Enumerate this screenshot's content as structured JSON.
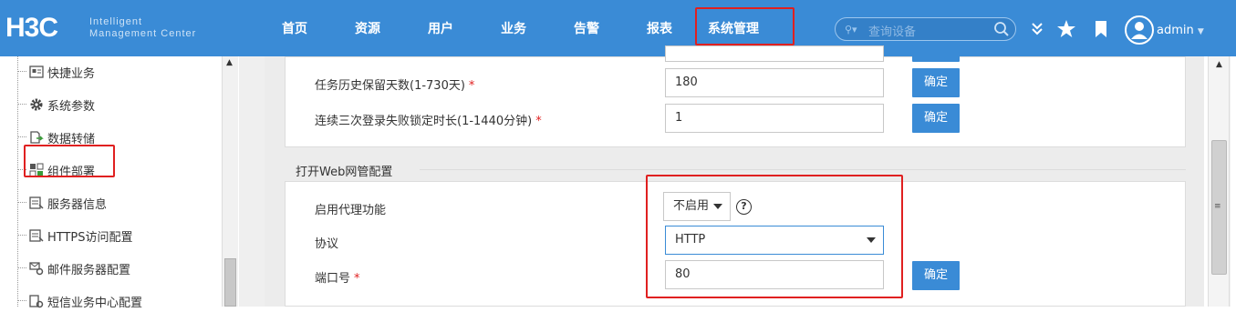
{
  "header": {
    "logo_main": "H3C",
    "logo_line1": "Intelligent",
    "logo_line2": "Management Center",
    "nav": [
      {
        "label": "首页"
      },
      {
        "label": "资源"
      },
      {
        "label": "用户"
      },
      {
        "label": "业务"
      },
      {
        "label": "告警"
      },
      {
        "label": "报表"
      },
      {
        "label": "系统管理",
        "active": true
      }
    ],
    "search": {
      "placeholder": "查询设备",
      "icon": "search-icon"
    },
    "icons": [
      "double-chevron-down-icon",
      "star-icon",
      "bookmark-icon",
      "user-avatar-icon"
    ],
    "user": "admin",
    "accent": "#3a8bd6",
    "highlight": "#e02020"
  },
  "sidebar": {
    "items": [
      {
        "label": "快捷业务",
        "icon": "shortcut-icon"
      },
      {
        "label": "系统参数",
        "icon": "gear-icon",
        "selected": true
      },
      {
        "label": "数据转储",
        "icon": "data-dump-icon"
      },
      {
        "label": "组件部署",
        "icon": "component-deploy-icon"
      },
      {
        "label": "服务器信息",
        "icon": "server-info-icon"
      },
      {
        "label": "HTTPS访问配置",
        "icon": "https-config-icon"
      },
      {
        "label": "邮件服务器配置",
        "icon": "mail-server-icon"
      },
      {
        "label": "短信业务中心配置",
        "icon": "sms-center-icon"
      }
    ]
  },
  "form_top": {
    "rows": [
      {
        "label": "任务历史保留天数(1-730天)",
        "required": "*",
        "value": "180",
        "button": "确定"
      },
      {
        "label": "连续三次登录失败锁定时长(1-1440分钟)",
        "required": "*",
        "value": "1",
        "button": "确定"
      }
    ]
  },
  "web_section": {
    "title": "打开Web网管配置",
    "proxy_label": "启用代理功能",
    "proxy_value": "不启用",
    "protocol_label": "协议",
    "protocol_value": "HTTP",
    "port_label": "端口号",
    "port_required": "*",
    "port_value": "80",
    "button": "确定"
  }
}
